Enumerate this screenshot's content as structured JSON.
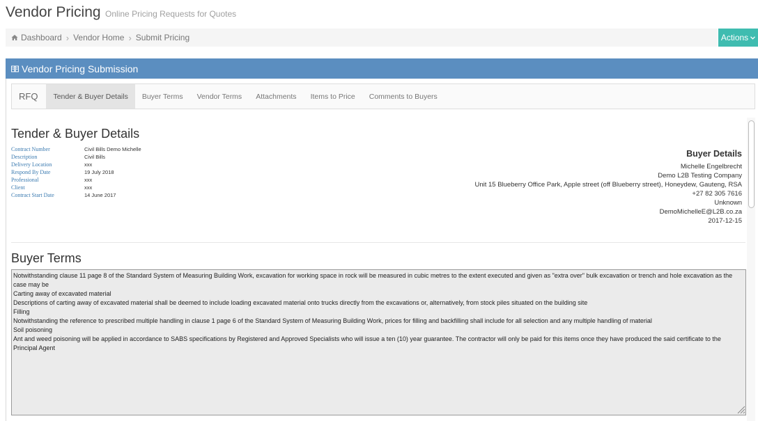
{
  "header": {
    "title": "Vendor Pricing",
    "subtitle": "Online Pricing Requests for Quotes"
  },
  "breadcrumb": {
    "items": [
      "Dashboard",
      "Vendor Home",
      "Submit Pricing"
    ]
  },
  "actions": {
    "label": "Actions"
  },
  "panel": {
    "title": "Vendor Pricing Submission"
  },
  "tabs": [
    "RFQ",
    "Tender & Buyer Details",
    "Buyer Terms",
    "Vendor Terms",
    "Attachments",
    "Items to Price",
    "Comments to Buyers"
  ],
  "tender": {
    "title": "Tender & Buyer Details",
    "fields": [
      {
        "label": "Contract Number",
        "value": "Civil Bills Demo Michelle"
      },
      {
        "label": "Description",
        "value": "Civil Bills"
      },
      {
        "label": "Delivery Location",
        "value": "xxx"
      },
      {
        "label": "Respond By Date",
        "value": "19 July 2018"
      },
      {
        "label": "Professional",
        "value": "xxx"
      },
      {
        "label": "Client",
        "value": "xxx"
      },
      {
        "label": "Contract Start Date",
        "value": "14 June 2017"
      }
    ]
  },
  "buyer": {
    "title": "Buyer Details",
    "name": "Michelle Engelbrecht",
    "company": "Demo L2B Testing Company",
    "address": "Unit 15 Blueberry Office Park, Apple street (off Blueberry street), Honeydew, Gauteng, RSA",
    "phone": "+27 82 305 7616",
    "other": "Unknown",
    "email": "DemoMichelleE@L2B.co.za",
    "date": "2017-12-15"
  },
  "buyer_terms": {
    "title": "Buyer Terms",
    "lines": [
      "Notwithstanding clause 11 page 8 of the Standard System of Measuring Building Work, excavation for working space in rock will be measured in cubic metres to the extent executed and given as \"extra over\" bulk excavation or trench and hole excavation as the case may be",
      "Carting away of excavated material",
      "Descriptions of carting away of excavated material shall be deemed to include loading excavated material onto trucks directly from the excavations or, alternatively, from stock piles situated on the building site",
      "Filling",
      "Notwithstanding the reference to prescribed multiple handling in clause 1 page 6 of the Standard System of Measuring Building Work, prices for filling and backfilling shall include for all selection and any multiple handling of material",
      "Soil poisoning",
      "Ant and weed poisoning will be applied in accordance to SABS specifications by Registered and Approved Specialists who will issue a ten (10) year guarantee. The contractor will only be paid for this items once they have produced the said certificate to the Principal Agent"
    ]
  },
  "colors": {
    "panel_heading": "#5b8ec0",
    "actions_button": "#3fbcb0",
    "label_blue": "#3a7ab0"
  }
}
